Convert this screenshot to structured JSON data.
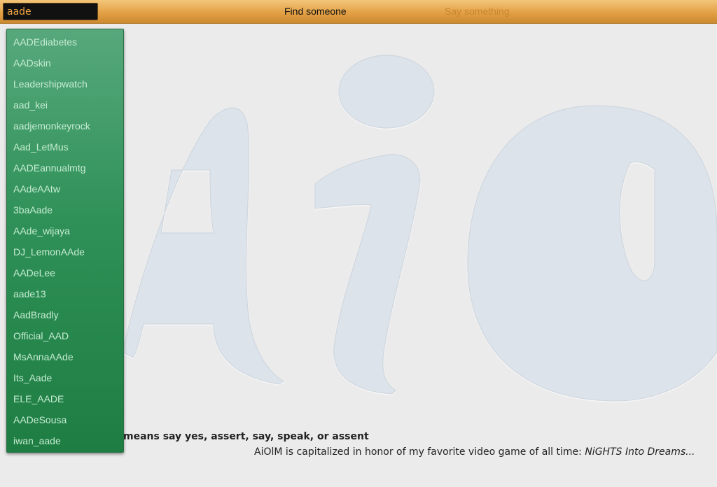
{
  "topbar": {
    "search_value": "aade",
    "find_label": "Find someone",
    "say_label": "Say something"
  },
  "logo": {
    "text": "AiO"
  },
  "suggestions": [
    "AADEdiabetes",
    "AADskin",
    "Leadershipwatch",
    "aad_kei",
    "aadjemonkeyrock",
    "Aad_LetMus",
    "AADEannualmtg",
    "AAdeAAtw",
    "3baAade",
    "AAde_wijaya",
    "DJ_LemonAAde",
    "AADeLee",
    "aade13",
    "AadBradly",
    "Official_AAD",
    "MsAnnaAAde",
    "Its_Aade",
    "ELE_AADE",
    "AADeSousa",
    "iwan_aade"
  ],
  "footer": {
    "line1": "means say yes, assert, say, speak, or assent",
    "line2_prefix": "AiOlM is capitalized in honor of my favorite video game of all time: ",
    "line2_italic": "NiGHTS Into Dreams..."
  },
  "colors": {
    "topbar": "#e3a045",
    "dropdown": "#2f9158",
    "logo_letters": "#dde3ea"
  }
}
